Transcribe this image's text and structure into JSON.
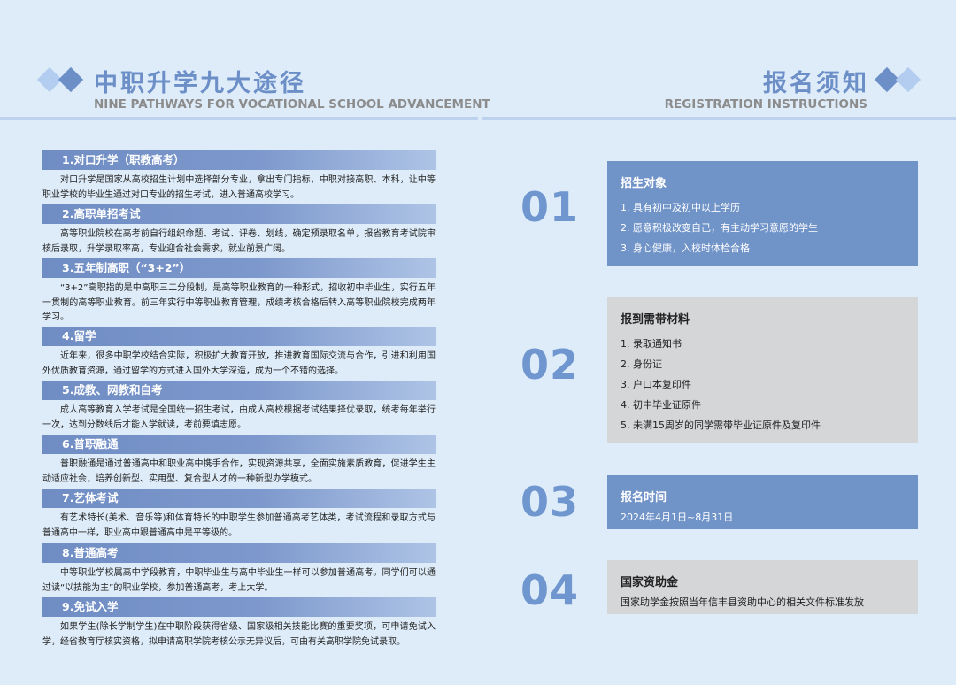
{
  "colors": {
    "accent": "#6f96cf",
    "bar": "#7d98cc",
    "box_blue": "#7093c8",
    "box_grey": "#d5d6d8",
    "background": "#deecf9"
  },
  "left_header": {
    "title": "中职升学九大途径",
    "subtitle": "NINE PATHWAYS FOR VOCATIONAL SCHOOL ADVANCEMENT"
  },
  "right_header": {
    "title": "报名须知",
    "subtitle": "REGISTRATION INSTRUCTIONS"
  },
  "pathways": [
    {
      "title": "1.对口升学（职教高考）",
      "body": "对口升学是国家从高校招生计划中选择部分专业，拿出专门指标，中职对接高职、本科，让中等职业学校的毕业生通过对口专业的招生考试，进入普通高校学习。"
    },
    {
      "title": "2.高职单招考试",
      "body": "高等职业院校在高考前自行组织命题、考试、评卷、划线，确定预录取名单，报省教育考试院审核后录取，升学录取率高，专业迎合社会需求，就业前景广阔。"
    },
    {
      "title": "3.五年制高职（“3+2”）",
      "body": "“3+2”高职指的是中高职三二分段制，是高等职业教育的一种形式，招收初中毕业生，实行五年一贯制的高等职业教育。前三年实行中等职业教育管理，成绩考核合格后转入高等职业院校完成两年学习。"
    },
    {
      "title": "4.留学",
      "body": "近年来，很多中职学校结合实际，积极扩大教育开放，推进教育国际交流与合作，引进和利用国外优质教育资源，通过留学的方式进入国外大学深造，成为一个不错的选择。"
    },
    {
      "title": "5.成教、网教和自考",
      "body": "成人高等教育入学考试是全国统一招生考试，由成人高校根据考试结果择优录取，统考每年举行一次，达到分数线后才能入学就读，考前要填志愿。"
    },
    {
      "title": "6.普职融通",
      "body": "普职融通是通过普通高中和职业高中携手合作，实现资源共享，全面实施素质教育，促进学生主动适应社会，培养创新型、实用型、复合型人才的一种新型办学模式。"
    },
    {
      "title": "7.艺体考试",
      "body": "有艺术特长(美术、音乐等)和体育特长的中职学生参加普通高考艺体类，考试流程和录取方式与普通高中一样，职业高中跟普通高中是平等级的。"
    },
    {
      "title": "8.普通高考",
      "body": "中等职业学校属高中学段教育，中职毕业生与高中毕业生一样可以参加普通高考。同学们可以通过读“以技能为主”的职业学校，参加普通高考，考上大学。"
    },
    {
      "title": "9.免试入学",
      "body": "如果学生(除长学制学生)在中职阶段获得省级、国家级相关技能比赛的重要奖项，可申请免试入学，经省教育厅核实资格，拟申请高职学院考核公示无异议后，可由有关高职学院免试录取。"
    }
  ],
  "notices": [
    {
      "number": "01",
      "title": "招生对象",
      "items": [
        "1. 具有初中及初中以上学历",
        "2. 愿意积极改变自己，有主动学习意愿的学生",
        "3. 身心健康，入校时体检合格"
      ]
    },
    {
      "number": "02",
      "title": "报到需带材料",
      "items": [
        "1. 录取通知书",
        "2. 身份证",
        "3. 户口本复印件",
        "4. 初中毕业证原件",
        "5. 未满15周岁的同学需带毕业证原件及复印件"
      ]
    },
    {
      "number": "03",
      "title": "报名时间",
      "text": "2024年4月1日~8月31日"
    },
    {
      "number": "04",
      "title": "国家资助金",
      "text": "国家助学金按照当年信丰县资助中心的相关文件标准发放"
    }
  ]
}
